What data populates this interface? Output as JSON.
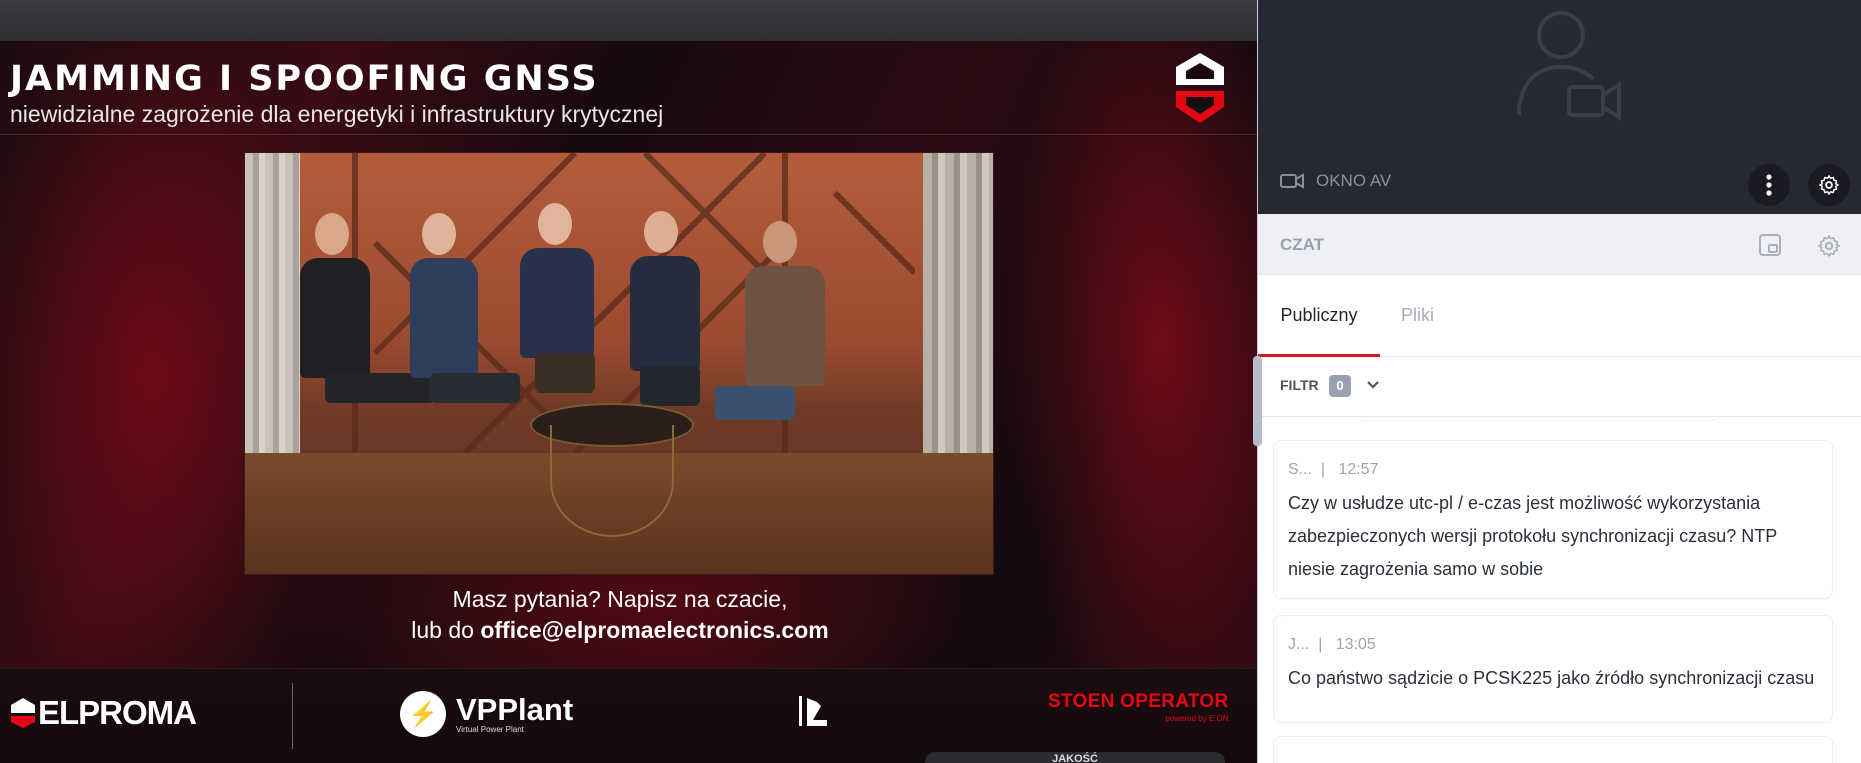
{
  "slide": {
    "title": "JAMMING I SPOOFING GNSS",
    "subtitle": "niewidzialne zagrożenie dla energetyki i infrastruktury krytycznej",
    "ask_line1": "Masz pytania? Napisz na czacie,",
    "ask_prefix": "lub do ",
    "ask_email": "office@elpromaelectronics.com"
  },
  "sponsors": {
    "elproma": "ELPROMA",
    "vpplant_name": "VPPlant",
    "vpplant_tagline": "Virtual Power Plant",
    "stoen_name": "STOEN OPERATOR",
    "stoen_sub": "powered by E.ON"
  },
  "bottom_pill": "JAKOŚĆ",
  "av_window": {
    "label": "OKNO AV"
  },
  "chat": {
    "title": "CZAT",
    "tabs": [
      "Publiczny",
      "Pliki"
    ],
    "active_tab": "Publiczny",
    "filter_label": "FILTR",
    "filter_count": "0",
    "messages": [
      {
        "author": "S...",
        "time": "12:57",
        "text": "Czy w  usłudze utc-pl / e-czas  jest możliwość wykorzystania zabezpieczonych wersji protokołu synchronizacji czasu? NTP niesie zagrożenia samo w sobie"
      },
      {
        "author": "J...",
        "time": "13:05",
        "text": "Co państwo sądzicie o PCSK225 jako źródło synchronizacji czasu"
      }
    ]
  },
  "colors": {
    "accent_red": "#d6161e",
    "brand_red": "#e30613",
    "av_background": "#262833",
    "chat_header_bg": "#eef0f5"
  },
  "icons": {
    "shield_logo": "elproma-shield-icon",
    "av_camera": "video-camera-icon",
    "av_placeholder": "user-video-placeholder-icon",
    "more": "more-vertical-icon",
    "settings": "gear-icon",
    "popout": "popout-icon",
    "chevron": "chevron-down-icon"
  }
}
